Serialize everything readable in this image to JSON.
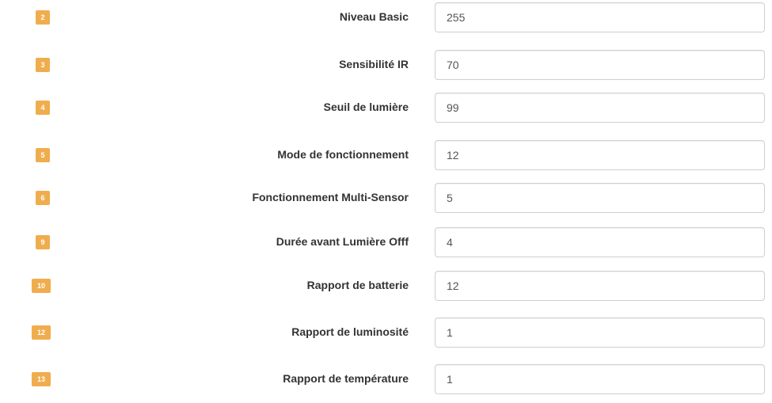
{
  "params": [
    {
      "num": "2",
      "label": "Niveau Basic",
      "value": "255"
    },
    {
      "num": "3",
      "label": "Sensibilité IR",
      "value": "70"
    },
    {
      "num": "4",
      "label": "Seuil de lumière",
      "value": "99"
    },
    {
      "num": "5",
      "label": "Mode de fonctionnement",
      "value": "12"
    },
    {
      "num": "6",
      "label": "Fonctionnement Multi-Sensor",
      "value": "5"
    },
    {
      "num": "9",
      "label": "Durée avant Lumière Offf",
      "value": "4"
    },
    {
      "num": "10",
      "label": "Rapport de batterie",
      "value": "12"
    },
    {
      "num": "12",
      "label": "Rapport de luminosité",
      "value": "1"
    },
    {
      "num": "13",
      "label": "Rapport de température",
      "value": "1"
    }
  ],
  "colors": {
    "badge": "#f0ad4e",
    "label": "#333333",
    "input_border": "#cfcfcf",
    "input_text": "#555555"
  }
}
